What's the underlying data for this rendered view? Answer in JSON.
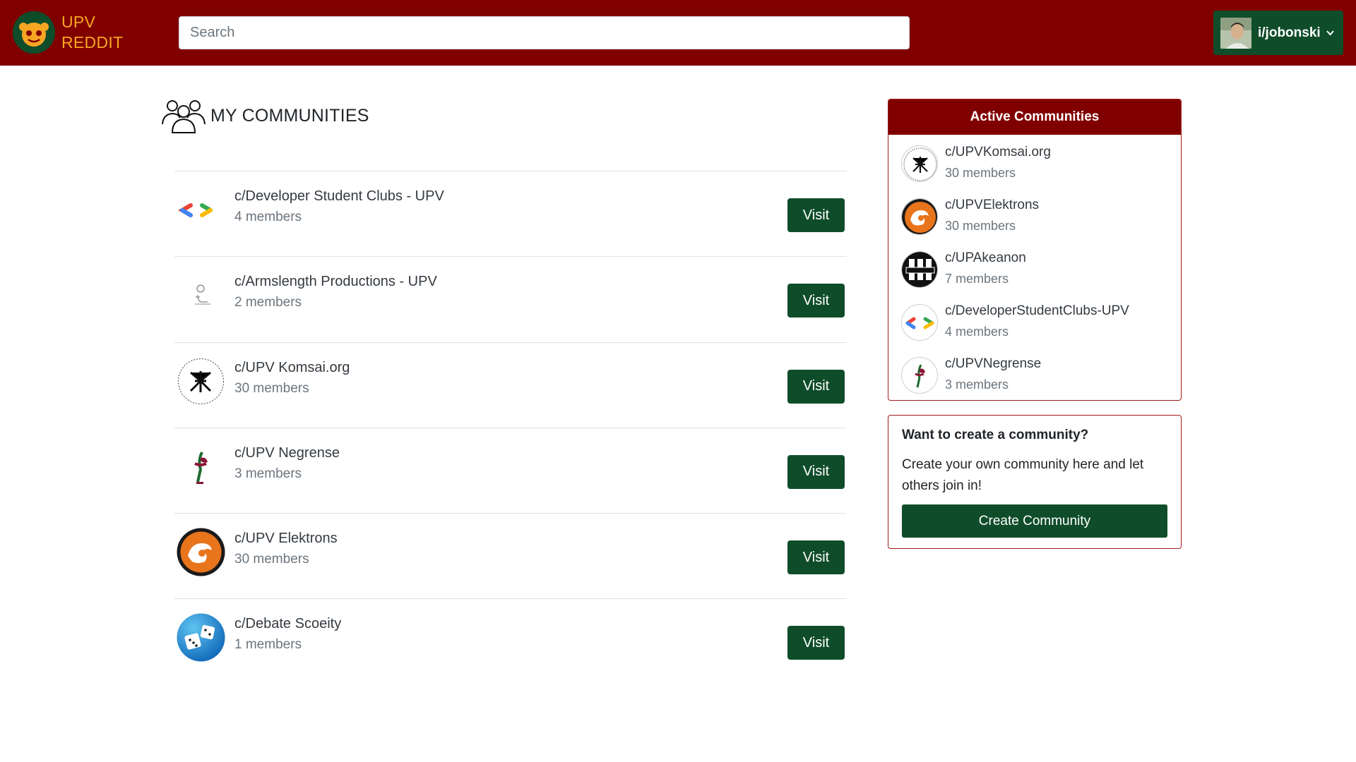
{
  "brand": {
    "line1": "UPV",
    "line2": "REDDIT",
    "logo_icon": "reddit-alien-logo"
  },
  "search": {
    "placeholder": "Search",
    "value": ""
  },
  "user": {
    "username": "i/jobonski",
    "avatar_icon": "user-avatar-photo",
    "chevron_icon": "chevron-down-icon"
  },
  "page": {
    "heading": "MY COMMUNITIES",
    "heading_icon": "people-group-icon"
  },
  "communities": [
    {
      "name": "c/Developer Student Clubs - UPV",
      "members": "4 members",
      "visit": "Visit",
      "icon": "dsc-logo"
    },
    {
      "name": "c/Armslength Productions - UPV",
      "members": "2 members",
      "visit": "Visit",
      "icon": "armslength-logo"
    },
    {
      "name": "c/UPV Komsai.org",
      "members": "30 members",
      "visit": "Visit",
      "icon": "komsai-logo"
    },
    {
      "name": "c/UPV Negrense",
      "members": "3 members",
      "visit": "Visit",
      "icon": "negrense-logo"
    },
    {
      "name": "c/UPV Elektrons",
      "members": "30 members",
      "visit": "Visit",
      "icon": "elektrons-logo"
    },
    {
      "name": "c/Debate Scoeity",
      "members": "1 members",
      "visit": "Visit",
      "icon": "dice-logo"
    }
  ],
  "active": {
    "title": "Active Communities",
    "items": [
      {
        "name": "c/UPVKomsai.org",
        "members": "30 members",
        "icon": "komsai-logo"
      },
      {
        "name": "c/UPVElektrons",
        "members": "30 members",
        "icon": "elektrons-logo"
      },
      {
        "name": "c/UPAkeanon",
        "members": "7 members",
        "icon": "akeanon-logo"
      },
      {
        "name": "c/DeveloperStudentClubs-UPV",
        "members": "4 members",
        "icon": "dsc-logo"
      },
      {
        "name": "c/UPVNegrense",
        "members": "3 members",
        "icon": "negrense-logo"
      }
    ]
  },
  "create": {
    "title": "Want to create a community?",
    "text": "Create your own community here and let others join in!",
    "button": "Create Community"
  },
  "colors": {
    "maroon": "#800000",
    "green": "#0f4d2a",
    "brand_text": "#f6a623",
    "muted": "#6c757d"
  }
}
